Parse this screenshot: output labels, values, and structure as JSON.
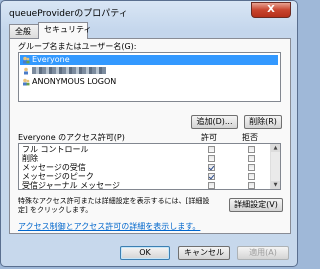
{
  "window": {
    "title": "queueProviderのプロパティ",
    "close_label": "X"
  },
  "tabs": [
    {
      "label": "全般"
    },
    {
      "label": "セキュリティ"
    }
  ],
  "group": {
    "label": "グループ名またはユーザー名(G):",
    "items": [
      {
        "label": "Everyone"
      },
      {
        "label": ""
      },
      {
        "label": "ANONYMOUS LOGON"
      }
    ],
    "add_label": "追加(D)...",
    "remove_label": "削除(R)"
  },
  "permissions": {
    "header": "Everyone のアクセス許可(P)",
    "allow_header": "許可",
    "deny_header": "拒否",
    "rows": [
      {
        "label": "フル コントロール",
        "allow": false,
        "deny": false
      },
      {
        "label": "削除",
        "allow": false,
        "deny": false
      },
      {
        "label": "メッセージの受信",
        "allow": true,
        "deny": false
      },
      {
        "label": "メッセージのピーク",
        "allow": true,
        "deny": false
      },
      {
        "label": "受信ジャーナル メッセージ",
        "allow": false,
        "deny": false
      }
    ]
  },
  "advanced": {
    "text_line1": "特殊なアクセス許可または詳細設定を表示するには、[詳細設",
    "text_line2": "定] をクリックします。",
    "button_label": "詳細設定(V)"
  },
  "learn_more_link": "アクセス制御とアクセス許可の詳細を表示します。",
  "footer": {
    "ok_label": "OK",
    "cancel_label": "キャンセル",
    "apply_label": "適用(A)"
  }
}
